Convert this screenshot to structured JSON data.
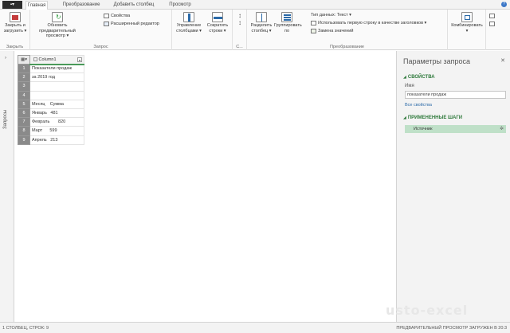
{
  "tabs": {
    "file": "",
    "items": [
      "Главная",
      "Преобразование",
      "Добавить столбец",
      "Просмотр"
    ]
  },
  "ribbon": {
    "close_group": {
      "label": "Закрыть",
      "btn": "Закрыть и загрузить"
    },
    "query_group": {
      "label": "Запрос",
      "refresh": "Обновить предварительный просмотр",
      "properties": "Свойства",
      "advanced": "Расширенный редактор"
    },
    "columns_group": {
      "label": "",
      "manage": "Управление столбцами",
      "reduce": "Сократить строки"
    },
    "sort_group": {
      "label": "С..."
    },
    "transform_group": {
      "label": "Преобразование",
      "split": "Разделить столбец",
      "group": "Группировать по",
      "datatype": "Тип данных: Текст",
      "first_row": "Использовать первую строку в качестве заголовков",
      "replace": "Замена значений"
    },
    "combine_group": {
      "label": "",
      "combine": "Комбинировать"
    }
  },
  "queries_pane": {
    "label": "Запросы"
  },
  "grid": {
    "column_header": "Column1",
    "rows": [
      {
        "n": "1",
        "v": "Показатели продаж"
      },
      {
        "n": "2",
        "v": "за 2019 год"
      },
      {
        "n": "3",
        "v": ""
      },
      {
        "n": "4",
        "v": ""
      },
      {
        "n": "5",
        "v": "Месяц    Сумма"
      },
      {
        "n": "6",
        "v": "Январь   481"
      },
      {
        "n": "7",
        "v": "Февраль       820"
      },
      {
        "n": "8",
        "v": "Март      599"
      },
      {
        "n": "9",
        "v": "Апрель   213"
      }
    ]
  },
  "settings": {
    "title": "Параметры запроса",
    "properties_header": "СВОЙСТВА",
    "name_label": "Имя",
    "name_value": "показатели продаж",
    "all_properties": "Все свойства",
    "steps_header": "ПРИМЕНЕННЫЕ ШАГИ",
    "steps": [
      "Источник"
    ]
  },
  "status": {
    "left": "1 СТОЛБЕЦ, СТРОК: 9",
    "right": "ПРЕДВАРИТЕЛЬНЫЙ ПРОСМОТР ЗАГРУЖЕН В 20:3",
    "watermark": "usto-excel"
  }
}
